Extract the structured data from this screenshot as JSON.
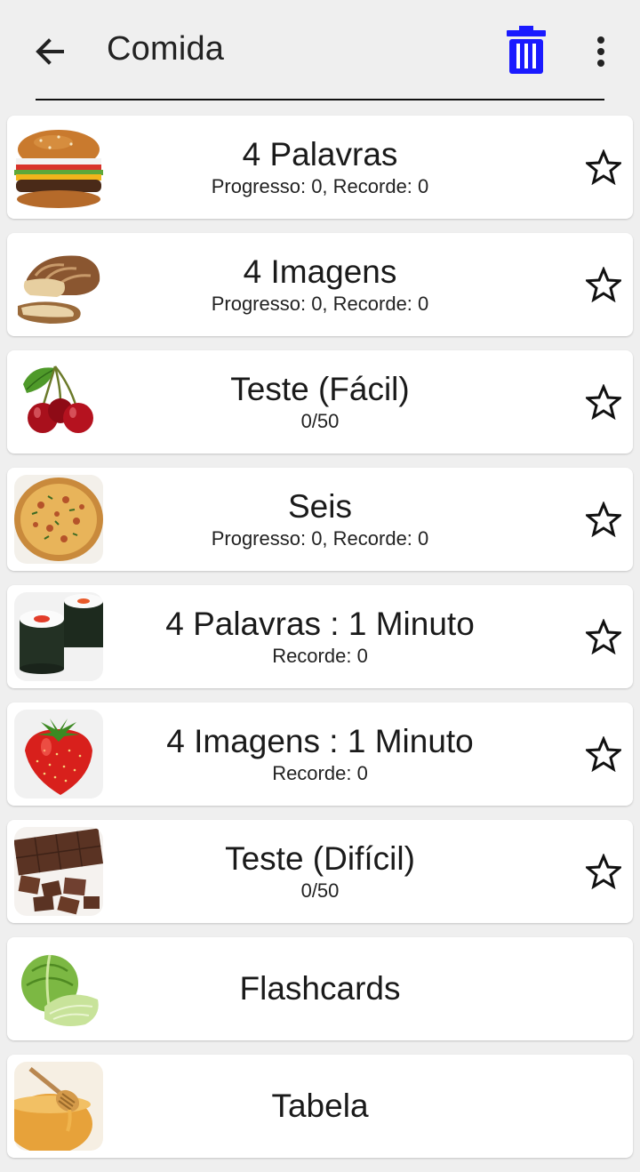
{
  "appbar": {
    "title": "Comida",
    "back_icon": "arrow-left-icon",
    "delete_icon": "trash-icon",
    "menu_icon": "more-vert-icon",
    "delete_color": "#1a1aff"
  },
  "items": [
    {
      "title": "4 Palavras",
      "subtitle": "Progresso: 0, Recorde: 0",
      "image": "hamburger",
      "favorite": false
    },
    {
      "title": "4 Imagens",
      "subtitle": "Progresso: 0, Recorde: 0",
      "image": "bread",
      "favorite": false
    },
    {
      "title": "Teste (Fácil)",
      "subtitle": "0/50",
      "image": "cherries",
      "favorite": false
    },
    {
      "title": "Seis",
      "subtitle": "Progresso: 0, Recorde: 0",
      "image": "pizza",
      "favorite": false
    },
    {
      "title": "4 Palavras : 1 Minuto",
      "subtitle": "Recorde: 0",
      "image": "sushi",
      "favorite": false
    },
    {
      "title": "4 Imagens : 1 Minuto",
      "subtitle": "Recorde: 0",
      "image": "strawberry",
      "favorite": false
    },
    {
      "title": "Teste (Difícil)",
      "subtitle": "0/50",
      "image": "chocolate",
      "favorite": false
    },
    {
      "title": "Flashcards",
      "image": "cabbage"
    },
    {
      "title": "Tabela",
      "image": "honey"
    }
  ]
}
